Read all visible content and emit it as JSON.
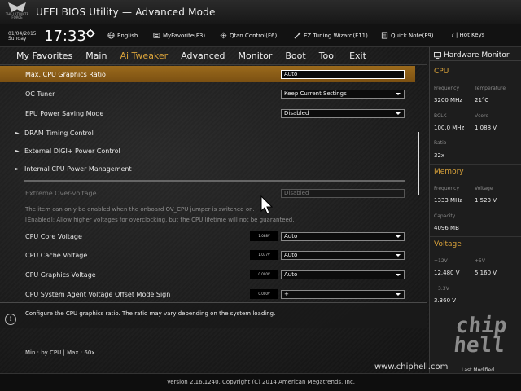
{
  "header": {
    "title": "UEFI BIOS Utility — Advanced Mode",
    "logo_text": "THE ULTIMATE FORCE"
  },
  "status": {
    "date": "01/04/2015",
    "day": "Sunday",
    "time": "17:33",
    "tools": [
      {
        "label": "English",
        "icon": "globe-icon"
      },
      {
        "label": "MyFavorite(F3)",
        "icon": "favorite-icon"
      },
      {
        "label": "Qfan Control(F6)",
        "icon": "fan-icon"
      },
      {
        "label": "EZ Tuning Wizard(F11)",
        "icon": "wizard-icon"
      },
      {
        "label": "Quick Note(F9)",
        "icon": "note-icon"
      },
      {
        "label": "? | Hot Keys",
        "icon": ""
      }
    ]
  },
  "tabs": [
    "My Favorites",
    "Main",
    "Ai Tweaker",
    "Advanced",
    "Monitor",
    "Boot",
    "Tool",
    "Exit"
  ],
  "active_tab": "Ai Tweaker",
  "settings": {
    "max_cpu_graphics_ratio": {
      "label": "Max. CPU Graphics Ratio",
      "value": "Auto"
    },
    "oc_tuner": {
      "label": "OC Tuner",
      "value": "Keep Current Settings"
    },
    "epu_power": {
      "label": "EPU Power Saving Mode",
      "value": "Disabled"
    },
    "dram_timing": {
      "label": "DRAM Timing Control"
    },
    "digi_power": {
      "label": "External DIGI+ Power Control"
    },
    "internal_power": {
      "label": "Internal CPU Power Management"
    },
    "extreme_ov": {
      "label": "Extreme Over-voltage",
      "value": "Disabled"
    },
    "note1": "The item can only be enabled when the onboard OV_CPU jumper is switched on.",
    "note2": "[Enabled]: Allow higher voltages for overclocking, but the CPU lifetime will not be guaranteed.",
    "cpu_core_voltage": {
      "label": "CPU Core Voltage",
      "reading": "1.088V",
      "value": "Auto"
    },
    "cpu_cache_voltage": {
      "label": "CPU Cache Voltage",
      "reading": "1.037V",
      "value": "Auto"
    },
    "cpu_graphics_voltage": {
      "label": "CPU Graphics Voltage",
      "reading": "0.000V",
      "value": "Auto"
    },
    "cpu_sa_voltage": {
      "label": "CPU System Agent Voltage Offset Mode Sign",
      "reading": "0.000V",
      "value": "+"
    }
  },
  "help": {
    "text": "Configure the CPU graphics ratio. The ratio may vary depending on the system loading.",
    "minmax": "Min.: by CPU   |   Max.: 60x"
  },
  "footer": {
    "version": "Version 2.16.1240. Copyright (C) 2014 American Megatrends, Inc.",
    "last_modified": "Last Modified",
    "site": "www.chiphell.com"
  },
  "hwmon": {
    "title": "Hardware Monitor",
    "cpu": {
      "heading": "CPU",
      "frequency_label": "Frequency",
      "frequency": "3200 MHz",
      "temperature_label": "Temperature",
      "temperature": "21°C",
      "bclk_label": "BCLK",
      "bclk": "100.0 MHz",
      "vcore_label": "Vcore",
      "vcore": "1.088 V",
      "ratio_label": "Ratio",
      "ratio": "32x"
    },
    "memory": {
      "heading": "Memory",
      "frequency_label": "Frequency",
      "frequency": "1333 MHz",
      "voltage_label": "Voltage",
      "voltage": "1.523 V",
      "capacity_label": "Capacity",
      "capacity": "4096 MB"
    },
    "voltage": {
      "heading": "Voltage",
      "v12_label": "+12V",
      "v12": "12.480 V",
      "v5_label": "+5V",
      "v5": "5.160 V",
      "v33_label": "+3.3V",
      "v33": "3.360 V"
    }
  },
  "watermark": "chip hell",
  "colors": {
    "accent": "#d9a23a",
    "highlight": "#8a5e18"
  }
}
